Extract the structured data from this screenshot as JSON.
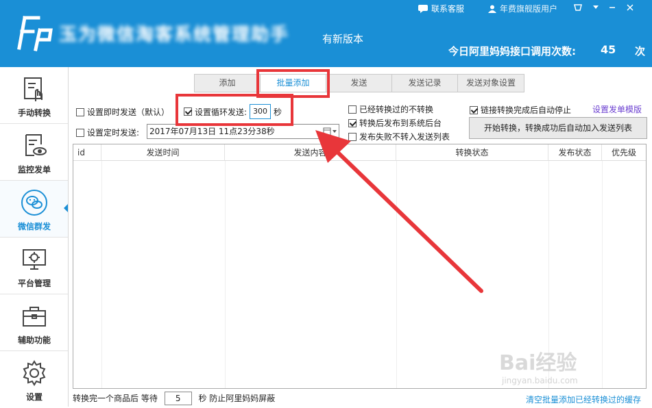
{
  "header": {
    "app_title": "玉为微信淘客系统管理助手",
    "new_version": "有新版本",
    "contact": "联系客服",
    "user": "年费旗舰版用户",
    "api_calls_label": "今日阿里妈妈接口调用次数:",
    "api_calls_count": "45",
    "api_calls_unit": "次"
  },
  "sidebar": {
    "items": [
      {
        "label": "手动转换",
        "icon": "hand-convert-icon"
      },
      {
        "label": "监控发单",
        "icon": "monitor-icon"
      },
      {
        "label": "微信群发",
        "icon": "wechat-icon"
      },
      {
        "label": "平台管理",
        "icon": "platform-icon"
      },
      {
        "label": "辅助功能",
        "icon": "toolbox-icon"
      },
      {
        "label": "设置",
        "icon": "gear-icon"
      }
    ]
  },
  "tabs": [
    "添加",
    "批量添加",
    "发送",
    "发送记录",
    "发送对象设置"
  ],
  "options": {
    "instant_send": "设置即时发送（默认）",
    "loop_send": "设置循环发送:",
    "loop_seconds": "300",
    "seconds_unit": "秒",
    "timed_send": "设置定时发送:",
    "timed_value": "2017年07月13日 11点23分38秒",
    "skip_converted": "已经转换过的不转换",
    "publish_backend": "转换后发布到系统后台",
    "fail_not_list": "发布失败不转入发送列表",
    "auto_stop": "链接转换完成后自动停止",
    "template_link": "设置发单模版",
    "start_button": "开始转换，转换成功后自动加入发送列表"
  },
  "table": {
    "columns": [
      "id",
      "发送时间",
      "发送内容",
      "转换状态",
      "发布状态",
      "优先级"
    ]
  },
  "bottom": {
    "wait_prefix": "转换完一个商品后 等待",
    "wait_value": "5",
    "wait_suffix": "秒 防止阿里妈妈屏蔽",
    "clear_link": "清空批量添加已经转换过的缓存"
  },
  "watermark": {
    "brand": "Bai经验",
    "site": "jingyan.baidu.com"
  },
  "colors": {
    "accent": "#1a8fd6",
    "highlight": "#e8363a"
  }
}
